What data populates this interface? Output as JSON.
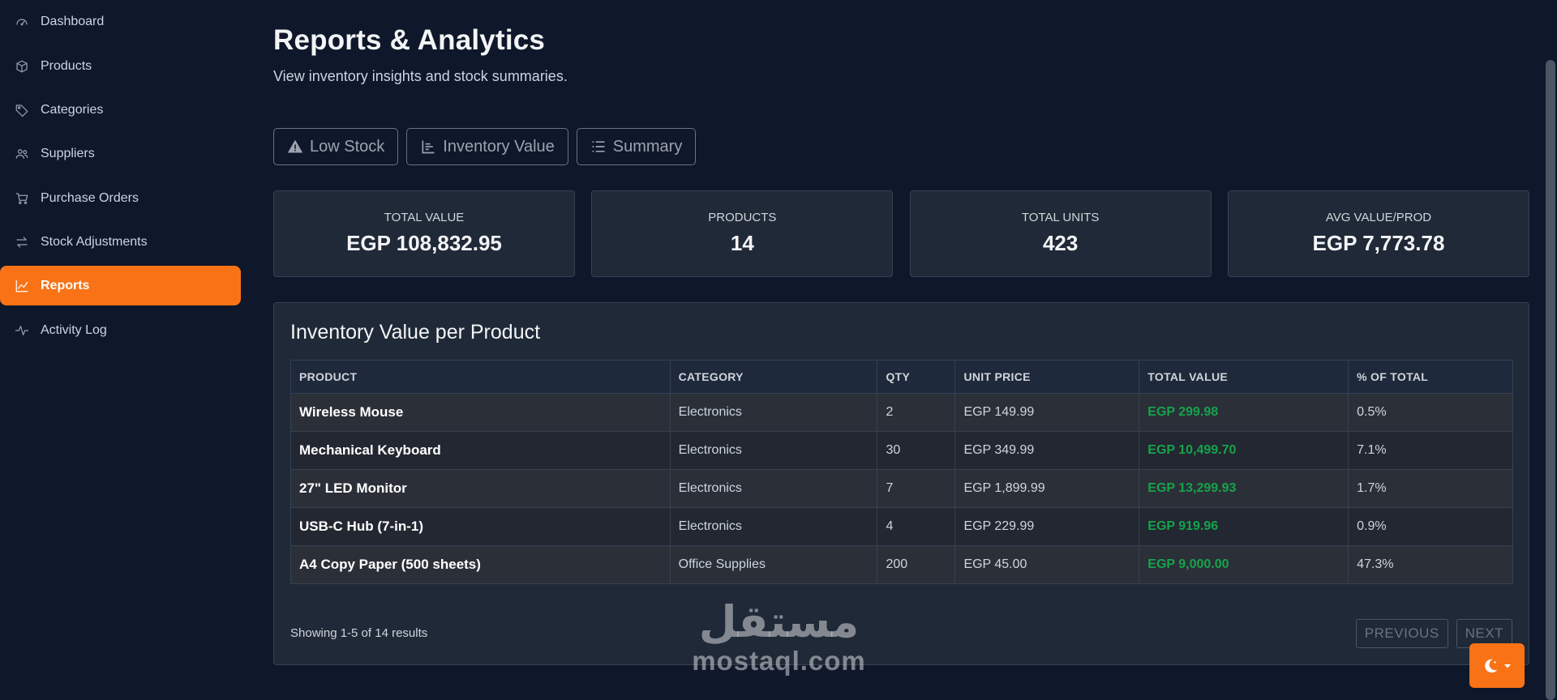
{
  "sidebar": {
    "items": [
      {
        "label": "Dashboard",
        "icon": "gauge-icon"
      },
      {
        "label": "Products",
        "icon": "box-icon"
      },
      {
        "label": "Categories",
        "icon": "tag-icon"
      },
      {
        "label": "Suppliers",
        "icon": "users-icon"
      },
      {
        "label": "Purchase Orders",
        "icon": "cart-icon"
      },
      {
        "label": "Stock Adjustments",
        "icon": "arrows-icon"
      },
      {
        "label": "Reports",
        "icon": "chart-line-icon",
        "active": true
      },
      {
        "label": "Activity Log",
        "icon": "activity-icon"
      }
    ]
  },
  "page": {
    "title": "Reports & Analytics",
    "subtitle": "View inventory insights and stock summaries."
  },
  "tabs": [
    {
      "label": "Low Stock",
      "icon": "warning-icon"
    },
    {
      "label": "Inventory Value",
      "icon": "bar-chart-icon"
    },
    {
      "label": "Summary",
      "icon": "list-icon"
    }
  ],
  "stats": [
    {
      "label": "TOTAL VALUE",
      "value": "EGP 108,832.95"
    },
    {
      "label": "PRODUCTS",
      "value": "14"
    },
    {
      "label": "TOTAL UNITS",
      "value": "423"
    },
    {
      "label": "AVG VALUE/PROD",
      "value": "EGP 7,773.78"
    }
  ],
  "panel": {
    "title": "Inventory Value per Product",
    "columns": [
      "PRODUCT",
      "CATEGORY",
      "QTY",
      "UNIT PRICE",
      "TOTAL VALUE",
      "% OF TOTAL"
    ],
    "rows": [
      [
        "Wireless Mouse",
        "Electronics",
        "2",
        "EGP 149.99",
        "EGP 299.98",
        "0.5%"
      ],
      [
        "Mechanical Keyboard",
        "Electronics",
        "30",
        "EGP 349.99",
        "EGP 10,499.70",
        "7.1%"
      ],
      [
        "27\" LED Monitor",
        "Electronics",
        "7",
        "EGP 1,899.99",
        "EGP 13,299.93",
        "1.7%"
      ],
      [
        "USB-C Hub (7-in-1)",
        "Electronics",
        "4",
        "EGP 229.99",
        "EGP 919.96",
        "0.9%"
      ],
      [
        "A4 Copy Paper (500 sheets)",
        "Office Supplies",
        "200",
        "EGP 45.00",
        "EGP 9,000.00",
        "47.3%"
      ]
    ],
    "showing": "Showing 1-5 of 14 results",
    "prev_label": "PREVIOUS",
    "next_label": "NEXT"
  },
  "watermark": {
    "arabic": "مستقل",
    "latin": "mostaql.com"
  },
  "colors": {
    "accent": "#f97316",
    "background": "#0f172a",
    "card": "#1f2937",
    "positive": "#16a34a"
  }
}
